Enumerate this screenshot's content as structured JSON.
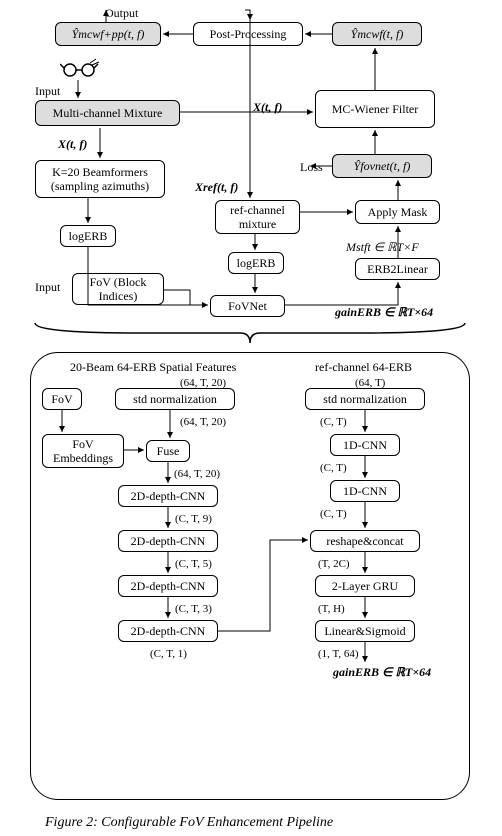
{
  "labels": {
    "output": "Output",
    "input1": "Input",
    "input2": "Input",
    "loss": "Loss",
    "Xtf1": "X(t, f)",
    "Xtf2": "X(t, f)",
    "Xref": "Xref(t, f)",
    "Ymcwfpp": "Ŷmcwf+pp(t, f)",
    "Ymcwf": "Ŷmcwf(t, f)",
    "Yfovnet": "Ŷfovnet(t, f)",
    "Mstft": "Mstft ∈ ℝT×F",
    "gainERB1": "gainERB ∈ ℝT×64",
    "gainERB2": "gainERB ∈ ℝT×64",
    "sec_spatial": "20-Beam 64-ERB Spatial Features",
    "sec_refch": "ref-channel 64-ERB",
    "shape_64T20_1": "(64, T, 20)",
    "shape_64T20_2": "(64, T, 20)",
    "shape_64T": "(64, T)",
    "shape_CT_1": "(C, T)",
    "shape_CT_2": "(C, T)",
    "shape_CT_3": "(C, T)",
    "shape_CT9": "(C, T, 9)",
    "shape_CT5": "(C, T, 5)",
    "shape_CT3": "(C, T, 3)",
    "shape_CT1": "(C, T, 1)",
    "shape_T2C": "(T, 2C)",
    "shape_TH": "(T, H)",
    "shape_1T64": "(1, T, 64)"
  },
  "boxes": {
    "multich": "Multi-channel Mixture",
    "beamformers": "K=20 Beamformers (sampling azimuths)",
    "logerb1": "logERB",
    "logerb2": "logERB",
    "fov_input": "FoV (Block Indices)",
    "fovnet": "FoVNet",
    "refmix": "ref-channel mixture",
    "erb2lin": "ERB2Linear",
    "applymask": "Apply Mask",
    "mcwiener": "MC-Wiener Filter",
    "postproc": "Post-Processing",
    "Ymcwfpp_box": "Ŷmcwf+pp(t, f)",
    "Ymcwf_box": "Ŷmcwf(t, f)",
    "Yfovnet_box": "Ŷfovnet(t, f)",
    "stdnorm1": "std normalization",
    "stdnorm2": "std normalization",
    "fov2": "FoV",
    "fovemb": "FoV Embeddings",
    "fuse": "Fuse",
    "cnn2d_1": "2D-depth-CNN",
    "cnn2d_2": "2D-depth-CNN",
    "cnn2d_3": "2D-depth-CNN",
    "cnn2d_4": "2D-depth-CNN",
    "cnn1d_1": "1D-CNN",
    "cnn1d_2": "1D-CNN",
    "reshape": "reshape&concat",
    "gru": "2-Layer GRU",
    "linsig": "Linear&Sigmoid"
  },
  "caption": "Figure 2: Configurable FoV Enhancement Pipeline"
}
